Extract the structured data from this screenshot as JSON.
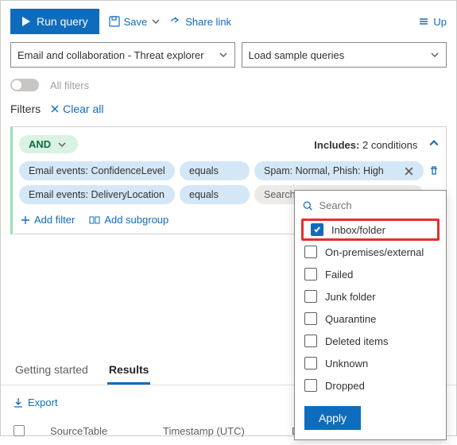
{
  "toolbar": {
    "run": "Run query",
    "save": "Save",
    "share": "Share link",
    "up": "Up"
  },
  "selects": {
    "scope": "Email and collaboration - Threat explorer",
    "sample": "Load sample queries"
  },
  "filters_toggle_label": "All filters",
  "filters_label": "Filters",
  "clear_all": "Clear all",
  "query": {
    "logic_op": "AND",
    "includes_label": "Includes:",
    "includes_count": "2 conditions",
    "conditions": [
      {
        "field": "Email events: ConfidenceLevel",
        "op": "equals",
        "value": "Spam: Normal, Phish: High"
      },
      {
        "field": "Email events: DeliveryLocation",
        "op": "equals",
        "value": "Search",
        "search": true
      }
    ],
    "add_filter": "Add filter",
    "add_subgroup": "Add subgroup"
  },
  "dropdown": {
    "search_placeholder": "Search",
    "options": [
      {
        "label": "Inbox/folder",
        "checked": true
      },
      {
        "label": "On-premises/external",
        "checked": false
      },
      {
        "label": "Failed",
        "checked": false
      },
      {
        "label": "Junk folder",
        "checked": false
      },
      {
        "label": "Quarantine",
        "checked": false
      },
      {
        "label": "Deleted items",
        "checked": false
      },
      {
        "label": "Unknown",
        "checked": false
      },
      {
        "label": "Dropped",
        "checked": false
      }
    ],
    "apply": "Apply"
  },
  "tabs": {
    "getting_started": "Getting started",
    "results": "Results"
  },
  "export": "Export",
  "table": {
    "cols": {
      "source": "SourceTable",
      "timestamp": "Timestamp (UTC)",
      "device": "DeviceId"
    }
  }
}
